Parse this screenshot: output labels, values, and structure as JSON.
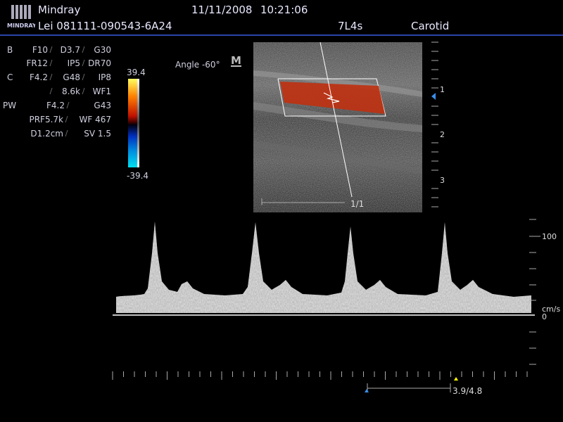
{
  "header": {
    "brand": "Mindray",
    "logo_text": "MINDRAY",
    "date": "11/11/2008",
    "time": "10:21:06",
    "patient_id": "Lei 081111-090543-6A24",
    "probe": "7L4s",
    "preset": "Carotid"
  },
  "params": {
    "b_label": "B",
    "b_f": "F10",
    "b_d": "D3.7",
    "b_g": "G30",
    "b_fr": "FR12",
    "b_ip": "IP5",
    "b_dr": "DR70",
    "c_label": "C",
    "c_f": "F4.2",
    "c_g": "G48",
    "c_ip": "IP8",
    "c_prf": "8.6k",
    "c_wf": "WF1",
    "pw_label": "PW",
    "pw_f": "F4.2",
    "pw_g": "G43",
    "pw_prf": "PRF5.7k",
    "pw_wf": "WF 467",
    "pw_d": "D1.2cm",
    "pw_sv": "SV 1.5"
  },
  "color_scale": {
    "max": "39.4",
    "min": "-39.4"
  },
  "angle": "Angle -60°",
  "m_marker": "M",
  "depth_marks": [
    "1",
    "2",
    "3"
  ],
  "image_frame": "1/1",
  "doppler": {
    "scale_100": "100",
    "unit": "cm/s",
    "baseline": "0",
    "sweep": "3.9/4.8"
  },
  "colors": {
    "header_line": "#2a44a8",
    "focus_marker": "#3a8ee8",
    "color_box": "#c03010"
  }
}
